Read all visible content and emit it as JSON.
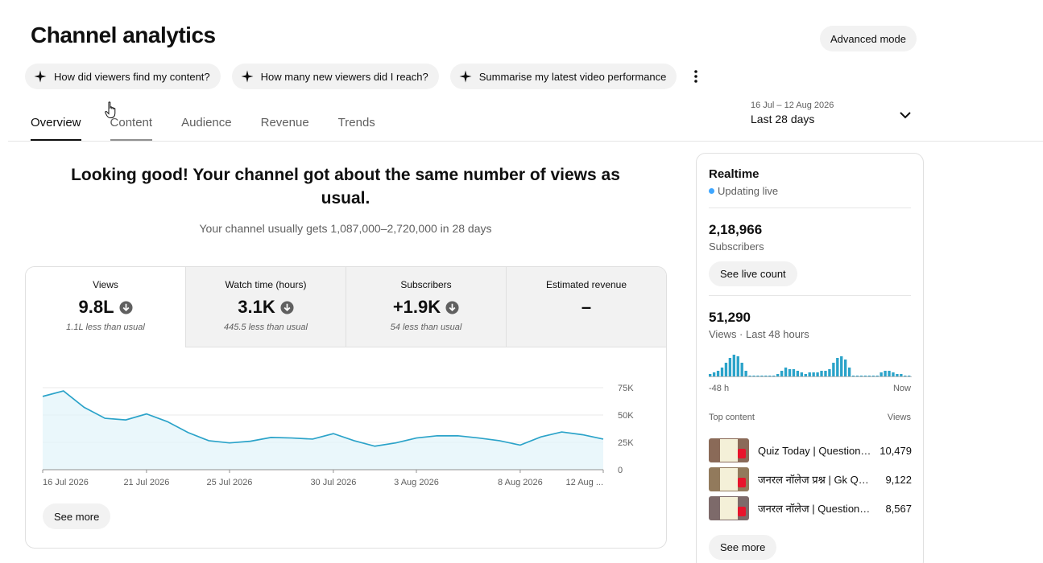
{
  "page": {
    "title": "Channel analytics",
    "advanced_mode_label": "Advanced mode"
  },
  "prompts": [
    {
      "label": "How did viewers find my content?",
      "icon": "sparkle-icon"
    },
    {
      "label": "How many new viewers did I reach?",
      "icon": "sparkle-icon"
    },
    {
      "label": "Summarise my latest video performance",
      "icon": "sparkle-icon"
    }
  ],
  "tabs": [
    {
      "label": "Overview",
      "active": true
    },
    {
      "label": "Content",
      "active": false
    },
    {
      "label": "Audience",
      "active": false
    },
    {
      "label": "Revenue",
      "active": false
    },
    {
      "label": "Trends",
      "active": false
    }
  ],
  "date_range": {
    "range_text": "16 Jul – 12 Aug 2026",
    "preset": "Last 28 days"
  },
  "summary": {
    "headline": "Looking good! Your channel got about the same number of views as usual.",
    "subline": "Your channel usually gets 1,087,000–2,720,000 in 28 days"
  },
  "metrics": [
    {
      "label": "Views",
      "value": "9.8L",
      "note": "1.1L less than usual",
      "trend": "down",
      "selected": true
    },
    {
      "label": "Watch time (hours)",
      "value": "3.1K",
      "note": "445.5 less than usual",
      "trend": "down",
      "selected": false
    },
    {
      "label": "Subscribers",
      "value": "+1.9K",
      "note": "54 less than usual",
      "trend": "down",
      "selected": false
    },
    {
      "label": "Estimated revenue",
      "value": "–",
      "note": "",
      "trend": "none",
      "selected": false
    }
  ],
  "overview_buttons": {
    "see_more": "See more"
  },
  "chart_data": {
    "type": "area",
    "series": [
      {
        "values": [
          67000,
          72000,
          57000,
          47000,
          45500,
          51000,
          44000,
          34000,
          26500,
          24500,
          26000,
          29500,
          29000,
          28000,
          33000,
          26500,
          21500,
          24500,
          29000,
          31000,
          31000,
          29000,
          26500,
          22500,
          30000,
          34500,
          32000,
          28000
        ]
      }
    ],
    "x_tick_labels": [
      "16 Jul 2026",
      "21 Jul 2026",
      "25 Jul 2026",
      "30 Jul 2026",
      "3 Aug 2026",
      "8 Aug 2026",
      "12 Aug ..."
    ],
    "x_tick_indices": [
      0,
      5,
      9,
      14,
      18,
      23,
      27
    ],
    "y_tick_labels": [
      "75K",
      "50K",
      "25K",
      "0"
    ],
    "y_ticks": [
      75000,
      50000,
      25000,
      0
    ],
    "ylim": [
      0,
      75000
    ],
    "grid": true,
    "color": "#2ba3c9"
  },
  "realtime": {
    "title": "Realtime",
    "status": "Updating live",
    "subscribers_value": "2,18,966",
    "subscribers_label": "Subscribers",
    "see_live_count": "See live count",
    "views_value": "51,290",
    "views_label": "Views · Last 48 hours",
    "axis_left": "-48 h",
    "axis_right": "Now",
    "hourly_views": [
      2,
      3,
      4,
      6,
      9,
      12,
      14,
      13,
      9,
      4,
      1,
      1,
      1,
      1,
      1,
      1,
      1,
      2,
      4,
      6,
      5,
      5,
      4,
      3,
      2,
      3,
      3,
      3,
      4,
      4,
      5,
      9,
      12,
      13,
      11,
      6,
      1,
      1,
      1,
      1,
      1,
      1,
      1,
      3,
      4,
      4,
      3,
      2,
      2,
      1,
      1
    ],
    "bar_color": "#2ba3c9",
    "top_content_label": "Top content",
    "views_col_label": "Views",
    "top_content": [
      {
        "title": "Quiz Today | Question…",
        "views": "10,479"
      },
      {
        "title": "जनरल नॉलेज प्रश्न | Gk Qui…",
        "views": "9,122"
      },
      {
        "title": "जनरल नॉलेज | Question …",
        "views": "8,567"
      }
    ],
    "see_more": "See more"
  }
}
